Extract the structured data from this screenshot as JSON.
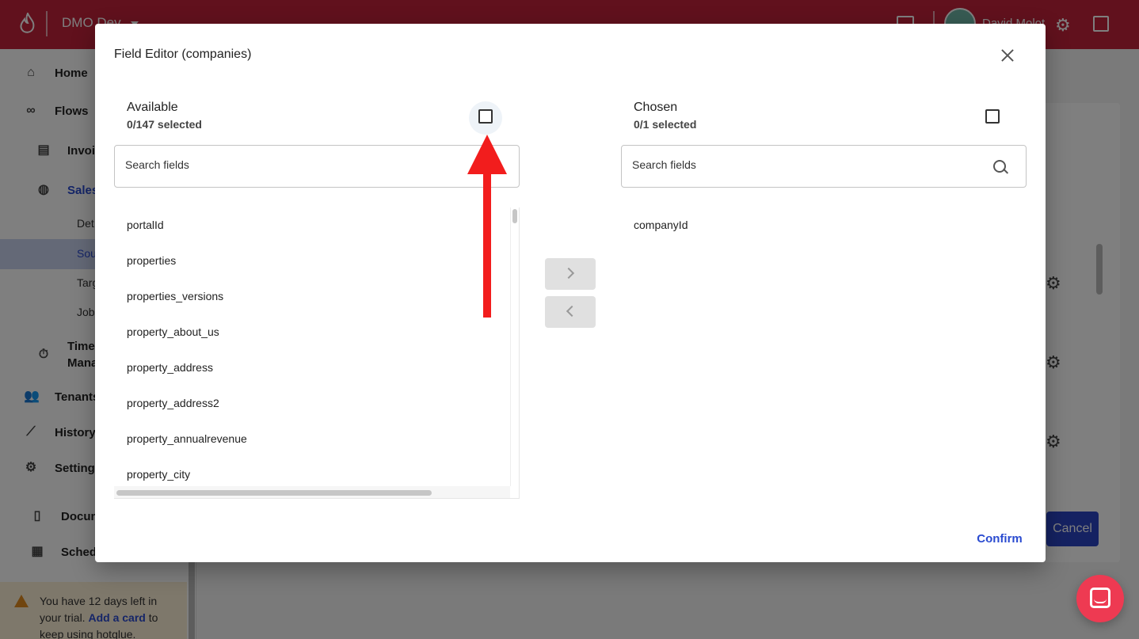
{
  "app": {
    "tenant_name": "DMO Dev",
    "user_name": "David Molot",
    "colors": {
      "brand": "#c2223b",
      "accent": "#2a4bd0",
      "arrow": "#f21d1d"
    }
  },
  "sidebar": {
    "items": [
      {
        "label": "Home",
        "icon": "home-icon"
      },
      {
        "label": "Flows",
        "icon": "link-icon"
      },
      {
        "label": "Invoic",
        "icon": "invoice-icon"
      },
      {
        "label": "Sales",
        "icon": "sales-icon"
      },
      {
        "label": "Time Mana",
        "icon": "stopwatch-icon"
      },
      {
        "label": "Tenants",
        "icon": "people-icon"
      },
      {
        "label": "History",
        "icon": "trend-icon"
      },
      {
        "label": "Settings",
        "icon": "gear-icon"
      },
      {
        "label": "Docum",
        "icon": "document-icon"
      },
      {
        "label": "Schedu",
        "icon": "calendar-icon"
      }
    ],
    "sub_items": [
      "Det",
      "Sou",
      "Targ",
      "Jobs"
    ],
    "trial": {
      "text_before": "You have 12 days left in your trial.",
      "link": "Add a card",
      "text_after": "to keep using hotglue."
    }
  },
  "background": {
    "cancel_label": "Cancel"
  },
  "dialog": {
    "title": "Field Editor (companies)",
    "available": {
      "title": "Available",
      "count": "0/147 selected",
      "search_placeholder": "Search fields",
      "items": [
        "portalId",
        "properties",
        "properties_versions",
        "property_about_us",
        "property_address",
        "property_address2",
        "property_annualrevenue",
        "property_city"
      ]
    },
    "chosen": {
      "title": "Chosen",
      "count": "0/1 selected",
      "search_placeholder": "Search fields",
      "items": [
        "companyId"
      ]
    },
    "confirm_label": "Confirm"
  }
}
